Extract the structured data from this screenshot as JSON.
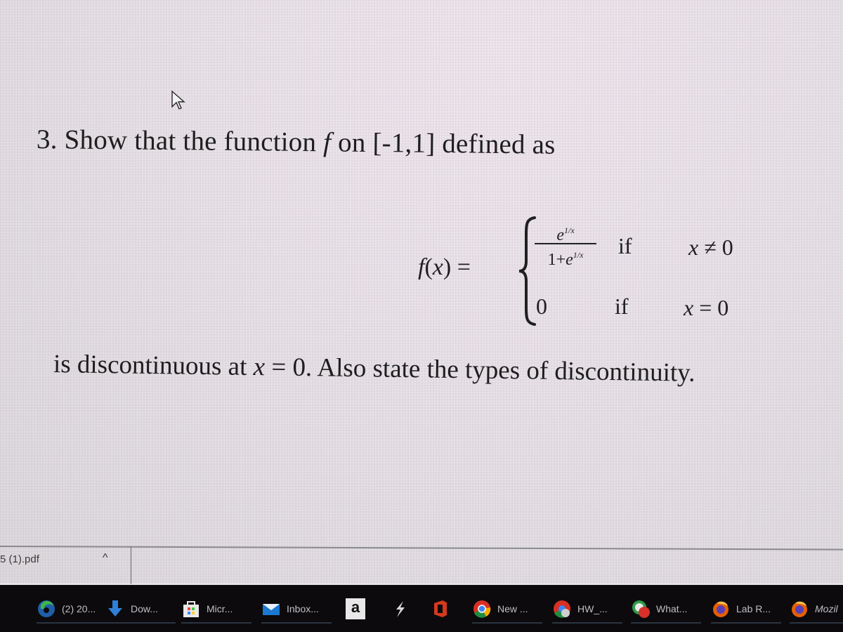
{
  "document": {
    "question_number": "3.",
    "line1_prefix": "Show that the function",
    "line1_var": "f",
    "line1_suffix": "on [-1,1] defined as",
    "formula": {
      "lhs_func": "f",
      "lhs_paren_open": "(",
      "lhs_var": "x",
      "lhs_paren_close": ")",
      "equals": "=",
      "case1": {
        "numerator_base": "e",
        "numerator_exponent": "1/x",
        "denominator_one_plus": "1+",
        "denominator_base": "e",
        "denominator_exponent": "1/x",
        "if_label": "if",
        "condition_var": "x",
        "condition_rest": "≠ 0"
      },
      "case2": {
        "value": "0",
        "if_label": "if",
        "condition_var": "x",
        "condition_rest": "= 0"
      }
    },
    "line2_prefix": "is discontinuous at",
    "line2_var": "x",
    "line2_suffix": "= 0. Also state the types of discontinuity."
  },
  "download_bar": {
    "file_name": "5 (1).pdf",
    "chevron": "^"
  },
  "taskbar": {
    "items": [
      {
        "label": "(2) 20...",
        "icon": "edge-icon"
      },
      {
        "label": "Dow...",
        "icon": "download-arrow-icon"
      },
      {
        "label": "Micr...",
        "icon": "microsoft-store-icon"
      },
      {
        "label": "Inbox...",
        "icon": "mail-icon"
      },
      {
        "label": "",
        "icon": "amazon-icon",
        "glyph": "a"
      },
      {
        "label": "",
        "icon": "lightning-app-icon"
      },
      {
        "label": "",
        "icon": "office-icon"
      },
      {
        "label": "New ...",
        "icon": "chrome-icon"
      },
      {
        "label": "HW_...",
        "icon": "chrome-profile-icon"
      },
      {
        "label": "What...",
        "icon": "whatsapp-icon"
      },
      {
        "label": "Lab R...",
        "icon": "firefox-icon"
      },
      {
        "label": "Mozil",
        "icon": "firefox-icon"
      }
    ]
  },
  "colors": {
    "taskbar_bg": "#0c0a0d",
    "text": "#1e1e1e",
    "taskbar_text": "#bfbfc4"
  }
}
